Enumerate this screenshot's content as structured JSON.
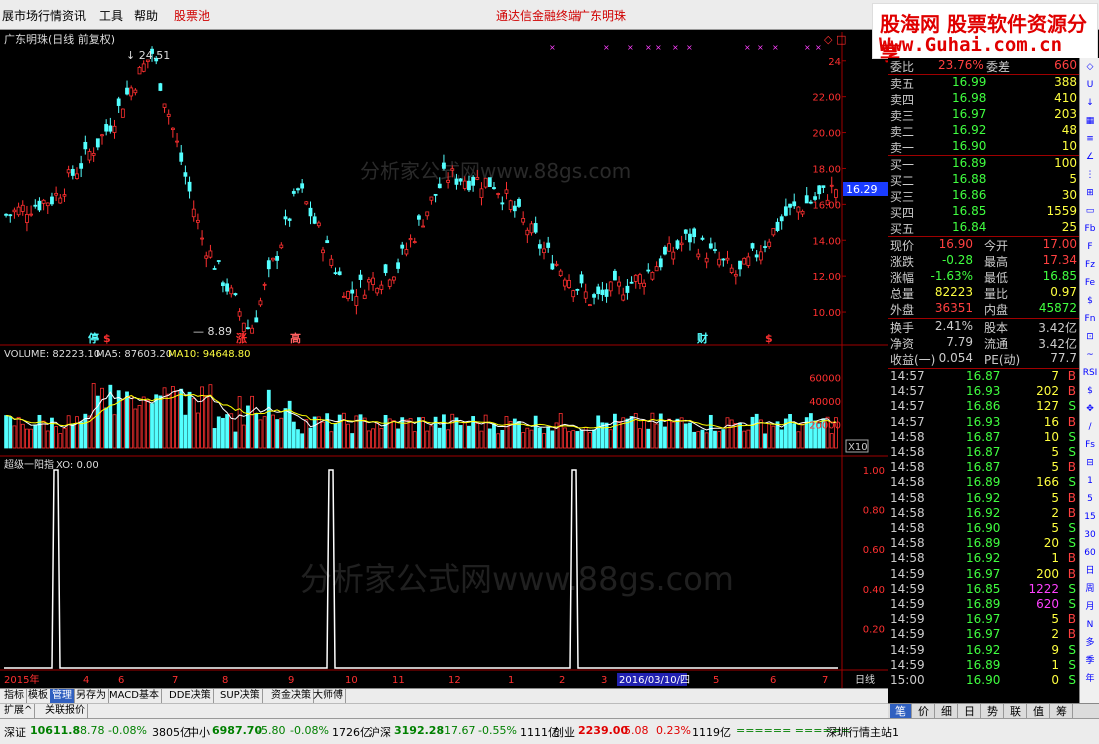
{
  "menubar": {
    "items": [
      "展市场行情",
      "资讯",
      "工具",
      "帮助",
      "股票池"
    ],
    "center_text": "通达信金融终端",
    "stock_name": "广东明珠"
  },
  "banner": {
    "line1": "股海网 股票软件资源分享",
    "line2": "Www.Guhai.com.cn"
  },
  "chart": {
    "title": "广东明珠(日线 前复权)",
    "watermark_top": "分析家公式网www.88gs.com",
    "watermark_bottom": "分析家公式网www.88gs.com",
    "high_label": "24.51",
    "low_label": "8.89",
    "price_tag": "16.29",
    "price_ticks": [
      "24",
      "22.00",
      "20.00",
      "18.00",
      "16.00",
      "14.00",
      "12.00",
      "10.00"
    ],
    "event_markers": [
      "停",
      "$",
      "涨",
      "高",
      "财",
      "$"
    ],
    "volume_label": "VOLUME: 82223.10",
    "ma5_label": "MA5: 87603.20",
    "ma10_label": "MA10: 94648.80",
    "volume_ticks": [
      "60000",
      "40000",
      "20000"
    ],
    "volume_unit": "X10",
    "indicator_label": "超级一阳指",
    "indicator_value": "XO: 0.00",
    "indicator_ticks": [
      "1.00",
      "0.80",
      "0.60",
      "0.40",
      "0.20"
    ],
    "x_labels": [
      "2015年",
      "4",
      "6",
      "7",
      "8",
      "9",
      "10",
      "11",
      "12",
      "1",
      "2",
      "3",
      "5",
      "6",
      "7"
    ],
    "cursor_date": "2016/03/10/四",
    "period": "日线",
    "colors": {
      "up": "#ff3030",
      "down": "#54ffff",
      "ma5": "#ffffff",
      "ma10": "#ffff00"
    }
  },
  "chart_data": {
    "type": "candlestick",
    "title": "广东明珠(日线 前复权)",
    "xlabel": "",
    "ylabel": "",
    "x_range": [
      "2015",
      "2016/07"
    ],
    "ylim": [
      9,
      24.6
    ],
    "max_price": 24.51,
    "min_price": 8.89,
    "last_price": 16.29,
    "approx_close_path": [
      {
        "x": "2015/01",
        "y": 15.4
      },
      {
        "x": "2015/03",
        "y": 16.4
      },
      {
        "x": "2015/04",
        "y": 19.9
      },
      {
        "x": "2015/06",
        "y": 24.51
      },
      {
        "x": "2015/07",
        "y": 14.2
      },
      {
        "x": "2015/07",
        "y": 8.89
      },
      {
        "x": "2015/08",
        "y": 16.9
      },
      {
        "x": "2015/09",
        "y": 11.0
      },
      {
        "x": "2015/10",
        "y": 12.5
      },
      {
        "x": "2015/11",
        "y": 17.6
      },
      {
        "x": "2015/12",
        "y": 17.2
      },
      {
        "x": "2016/01",
        "y": 13.5
      },
      {
        "x": "2016/02",
        "y": 10.6
      },
      {
        "x": "2016/03",
        "y": 11.9
      },
      {
        "x": "2016/04",
        "y": 14.2
      },
      {
        "x": "2016/05",
        "y": 12.0
      },
      {
        "x": "2016/06",
        "y": 15.5
      },
      {
        "x": "2016/07",
        "y": 16.9
      }
    ],
    "volume": {
      "ylim": [
        0,
        70000
      ],
      "ticks": [
        20000,
        40000,
        60000
      ],
      "last": 82223.1,
      "ma5": 87603.2,
      "ma10": 94648.8
    },
    "indicator": {
      "name": "超级一阳指",
      "ylim": [
        0,
        1.0
      ],
      "signal_months": [
        "2015/01",
        "2015/09",
        "2016/03"
      ]
    }
  },
  "quote": {
    "wei_bi_label": "委比",
    "wei_bi": "23.76%",
    "wei_cha_label": "委差",
    "wei_cha": "660",
    "asks": [
      {
        "label": "卖五",
        "price": "16.99",
        "vol": "388"
      },
      {
        "label": "卖四",
        "price": "16.98",
        "vol": "410"
      },
      {
        "label": "卖三",
        "price": "16.97",
        "vol": "203"
      },
      {
        "label": "卖二",
        "price": "16.92",
        "vol": "48"
      },
      {
        "label": "卖一",
        "price": "16.90",
        "vol": "10"
      }
    ],
    "bids": [
      {
        "label": "买一",
        "price": "16.89",
        "vol": "100"
      },
      {
        "label": "买二",
        "price": "16.88",
        "vol": "5"
      },
      {
        "label": "买三",
        "price": "16.86",
        "vol": "30"
      },
      {
        "label": "买四",
        "price": "16.85",
        "vol": "1559"
      },
      {
        "label": "买五",
        "price": "16.84",
        "vol": "25"
      }
    ],
    "stats": [
      {
        "l1": "现价",
        "v1": "16.90",
        "c1": "#ff4040",
        "l2": "今开",
        "v2": "17.00",
        "c2": "#ff4040"
      },
      {
        "l1": "涨跌",
        "v1": "-0.28",
        "c1": "#40ff40",
        "l2": "最高",
        "v2": "17.34",
        "c2": "#ff4040"
      },
      {
        "l1": "涨幅",
        "v1": "-1.63%",
        "c1": "#40ff40",
        "l2": "最低",
        "v2": "16.85",
        "c2": "#40ff40"
      },
      {
        "l1": "总量",
        "v1": "82223",
        "c1": "#ffff40",
        "l2": "量比",
        "v2": "0.97",
        "c2": "#ffff40"
      },
      {
        "l1": "外盘",
        "v1": "36351",
        "c1": "#ff4040",
        "l2": "内盘",
        "v2": "45872",
        "c2": "#40ff40"
      }
    ],
    "stats2": [
      {
        "l1": "换手",
        "v1": "2.41%",
        "l2": "股本",
        "v2": "3.42亿"
      },
      {
        "l1": "净资",
        "v1": "7.79",
        "l2": "流通",
        "v2": "3.42亿"
      },
      {
        "l1": "收益(一)",
        "v1": "0.054",
        "l2": "PE(动)",
        "v2": "77.7"
      }
    ]
  },
  "ticks": [
    {
      "t": "14:57",
      "p": "16.87",
      "v": "7",
      "bs": "B"
    },
    {
      "t": "14:57",
      "p": "16.93",
      "v": "202",
      "bs": "B"
    },
    {
      "t": "14:57",
      "p": "16.86",
      "v": "127",
      "bs": "S"
    },
    {
      "t": "14:57",
      "p": "16.93",
      "v": "16",
      "bs": "B"
    },
    {
      "t": "14:58",
      "p": "16.87",
      "v": "10",
      "bs": "S"
    },
    {
      "t": "14:58",
      "p": "16.87",
      "v": "5",
      "bs": "S"
    },
    {
      "t": "14:58",
      "p": "16.87",
      "v": "5",
      "bs": "B"
    },
    {
      "t": "14:58",
      "p": "16.89",
      "v": "166",
      "bs": "S"
    },
    {
      "t": "14:58",
      "p": "16.92",
      "v": "5",
      "bs": "B"
    },
    {
      "t": "14:58",
      "p": "16.92",
      "v": "2",
      "bs": "B"
    },
    {
      "t": "14:58",
      "p": "16.90",
      "v": "5",
      "bs": "S"
    },
    {
      "t": "14:58",
      "p": "16.89",
      "v": "20",
      "bs": "S"
    },
    {
      "t": "14:58",
      "p": "16.92",
      "v": "1",
      "bs": "B"
    },
    {
      "t": "14:59",
      "p": "16.97",
      "v": "200",
      "bs": "B"
    },
    {
      "t": "14:59",
      "p": "16.85",
      "v": "1222",
      "bs": "S"
    },
    {
      "t": "14:59",
      "p": "16.89",
      "v": "620",
      "bs": "S"
    },
    {
      "t": "14:59",
      "p": "16.97",
      "v": "5",
      "bs": "B"
    },
    {
      "t": "14:59",
      "p": "16.97",
      "v": "2",
      "bs": "B"
    },
    {
      "t": "14:59",
      "p": "16.92",
      "v": "9",
      "bs": "S"
    },
    {
      "t": "14:59",
      "p": "16.89",
      "v": "1",
      "bs": "S"
    },
    {
      "t": "15:00",
      "p": "16.90",
      "v": "0",
      "bs": "S"
    }
  ],
  "bottom_tabs": [
    "指标",
    "模板",
    "管理",
    "另存为",
    "MACD基本",
    "DDE决策",
    "SUP决策",
    "资金决策",
    "大师傅"
  ],
  "ext_tabs": [
    "扩展^",
    "关联报价"
  ],
  "panel_tabs": [
    "笔",
    "价",
    "细",
    "日",
    "势",
    "联",
    "值",
    "筹"
  ],
  "tool_strip": [
    "◇",
    "U",
    "↓",
    "▦",
    "≡",
    "∠",
    "⋮",
    "⊞",
    "▭",
    "Fb",
    "F",
    "Fz",
    "Fe",
    "$",
    "Fn",
    "⊡",
    "~",
    "RSI",
    "$",
    "✥",
    "/",
    "Fs",
    "⊟",
    "1",
    "5",
    "15",
    "30",
    "60",
    "日",
    "周",
    "月",
    "N",
    "多",
    "季",
    "年"
  ],
  "status": {
    "sz_label": "深证",
    "sz_val": "10611.8",
    "sz_chg": "-8.78",
    "sz_pct": "-0.08%",
    "sz_amt": "3805亿",
    "zx_label": "中小",
    "zx_val": "6987.70",
    "zx_chg": "-5.80",
    "zx_pct": "-0.08%",
    "zx_amt": "1726亿",
    "sh_label": "沪深",
    "sh_val": "3192.28",
    "sh_chg": "-17.67",
    "sh_pct": "-0.55%",
    "sh_amt": "1111亿",
    "cy_label": "创业",
    "cy_val": "2239.00",
    "cy_chg": "5.08",
    "cy_pct": "0.23%",
    "cy_amt": "1119亿",
    "signal": "====== ======",
    "server": "深圳行情主站1"
  }
}
